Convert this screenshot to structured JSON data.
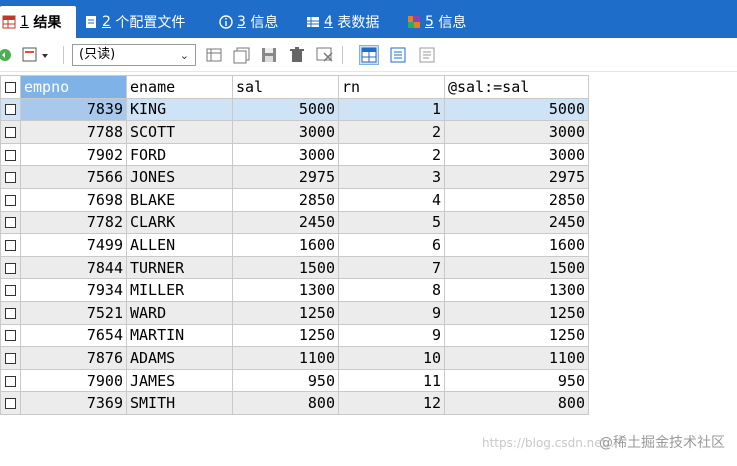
{
  "tabs": [
    {
      "num": "1",
      "label": "结果",
      "active": true
    },
    {
      "num": "2",
      "label": "个配置文件",
      "active": false
    },
    {
      "num": "3",
      "label": "信息",
      "active": false
    },
    {
      "num": "4",
      "label": "表数据",
      "active": false
    },
    {
      "num": "5",
      "label": "信息",
      "active": false
    }
  ],
  "toolbar": {
    "mode_value": "(只读)"
  },
  "grid": {
    "columns": [
      "empno",
      "ename",
      "sal",
      "rn",
      "@sal:=sal"
    ],
    "rows": [
      [
        "7839",
        "KING",
        "5000",
        "1",
        "5000"
      ],
      [
        "7788",
        "SCOTT",
        "3000",
        "2",
        "3000"
      ],
      [
        "7902",
        "FORD",
        "3000",
        "2",
        "3000"
      ],
      [
        "7566",
        "JONES",
        "2975",
        "3",
        "2975"
      ],
      [
        "7698",
        "BLAKE",
        "2850",
        "4",
        "2850"
      ],
      [
        "7782",
        "CLARK",
        "2450",
        "5",
        "2450"
      ],
      [
        "7499",
        "ALLEN",
        "1600",
        "6",
        "1600"
      ],
      [
        "7844",
        "TURNER",
        "1500",
        "7",
        "1500"
      ],
      [
        "7934",
        "MILLER",
        "1300",
        "8",
        "1300"
      ],
      [
        "7521",
        "WARD",
        "1250",
        "9",
        "1250"
      ],
      [
        "7654",
        "MARTIN",
        "1250",
        "9",
        "1250"
      ],
      [
        "7876",
        "ADAMS",
        "1100",
        "10",
        "1100"
      ],
      [
        "7900",
        "JAMES",
        "950",
        "11",
        "950"
      ],
      [
        "7369",
        "SMITH",
        "800",
        "12",
        "800"
      ]
    ]
  },
  "watermark": "@稀土掘金技术社区",
  "watermark_faint": "https://blog.csdn.net/..."
}
